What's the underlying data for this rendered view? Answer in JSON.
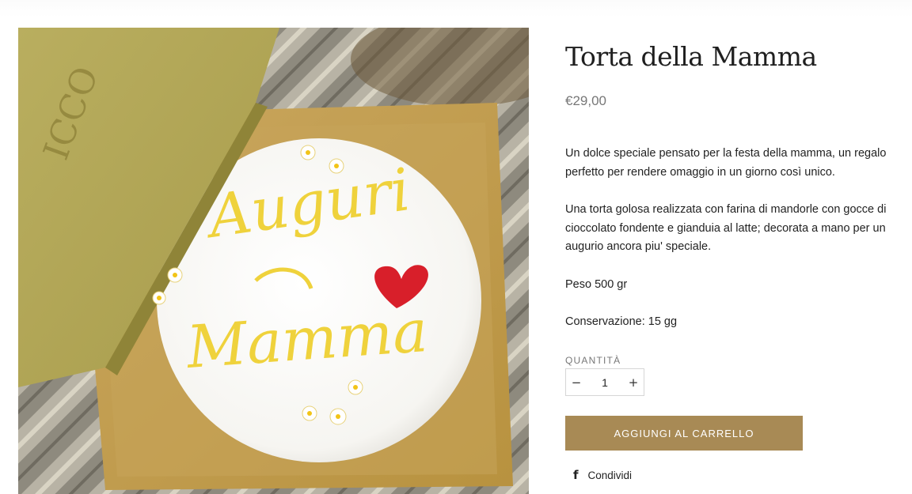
{
  "product": {
    "title": "Torta della Mamma",
    "price": "€29,00",
    "description": [
      "Un dolce speciale pensato per la festa della mamma, un regalo perfetto per rendere omaggio in un giorno così unico.",
      "Una torta golosa realizzata con farina di mandorle con gocce di cioccolato fondente e gianduia al latte; decorata a mano per un augurio ancora piu' speciale.",
      "Peso 500 gr",
      "Conservazione: 15 gg"
    ],
    "image_text": [
      "Auguri",
      "Mamma"
    ],
    "box_logo": "ICCO"
  },
  "quantity": {
    "label": "QUANTITÀ",
    "value": "1",
    "minus": "−",
    "plus": "+"
  },
  "actions": {
    "add_to_cart": "AGGIUNGI AL CARRELLO",
    "share_label": "Condividi",
    "share_icon": "facebook-icon",
    "share_glyph": "f"
  },
  "colors": {
    "accent": "#a88a55",
    "price": "#777777"
  }
}
